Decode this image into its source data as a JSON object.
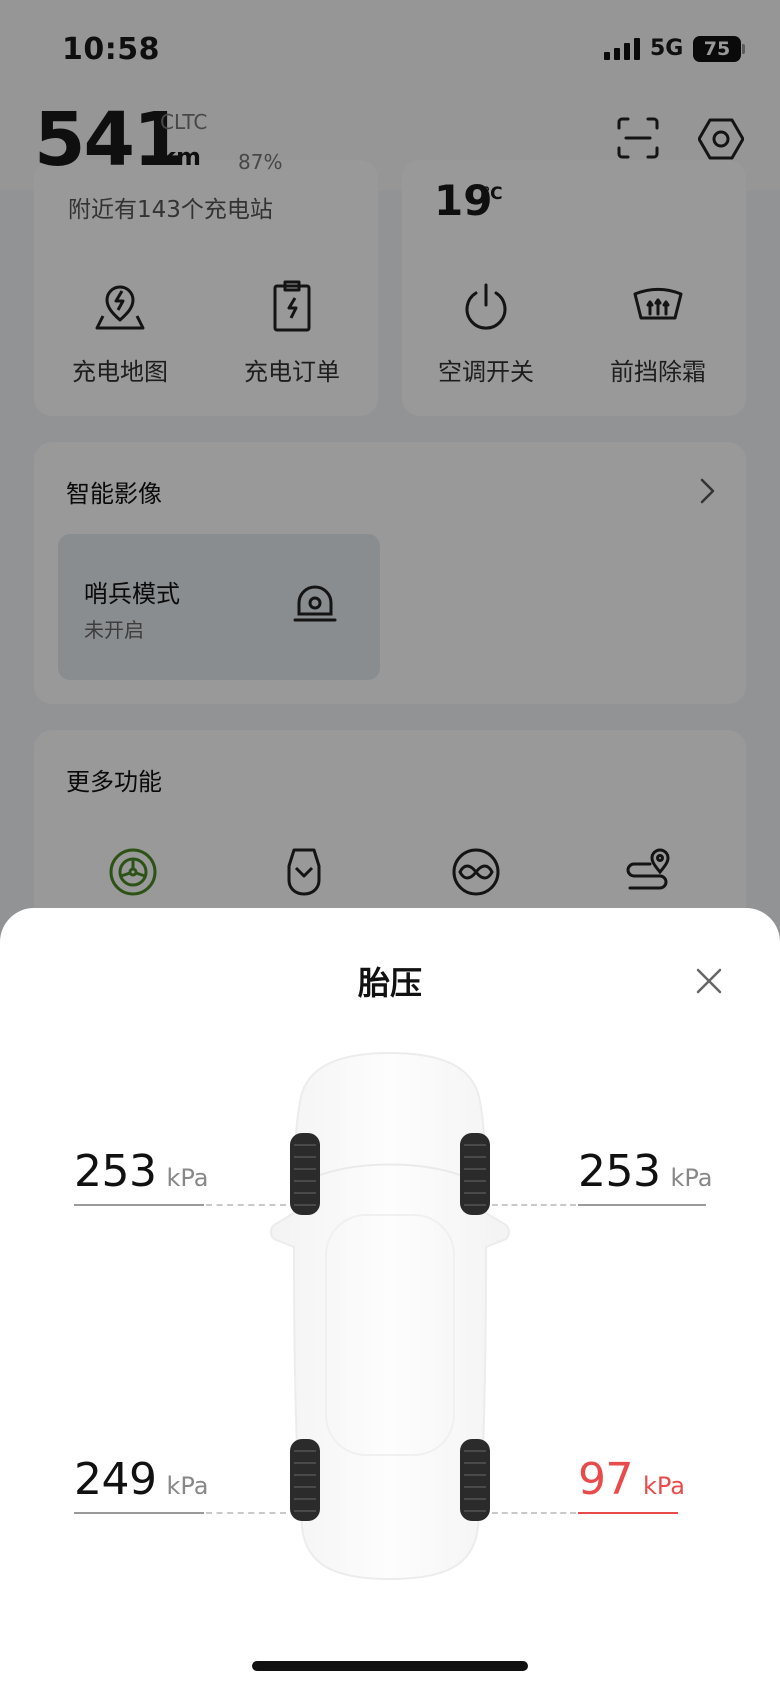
{
  "status_bar": {
    "time": "10:58",
    "network": "5G",
    "battery": "75"
  },
  "header": {
    "range_value": "541",
    "range_standard": "CLTC",
    "range_unit": "km",
    "state_of_charge": "87%"
  },
  "charging_card": {
    "nearby_text": "附近有143个充电站",
    "actions": [
      {
        "label": "充电地图",
        "icon": "charging-map-icon"
      },
      {
        "label": "充电订单",
        "icon": "charging-order-icon"
      }
    ]
  },
  "climate_card": {
    "temperature": "19",
    "temperature_unit": "℃",
    "actions": [
      {
        "label": "空调开关",
        "icon": "power-icon"
      },
      {
        "label": "前挡除霜",
        "icon": "windshield-defrost-icon"
      }
    ]
  },
  "smart_video": {
    "title": "智能影像",
    "sentry": {
      "title": "哨兵模式",
      "status": "未开启"
    }
  },
  "more_functions": {
    "title": "更多功能",
    "icons": [
      "tire-icon",
      "car-door-icon",
      "infinity-icon",
      "route-icon"
    ]
  },
  "tire_pressure_sheet": {
    "title": "胎压",
    "unit": "kPa",
    "front_left": "253",
    "front_right": "253",
    "rear_left": "249",
    "rear_right": "97",
    "alert_color": "#e94b4b"
  }
}
